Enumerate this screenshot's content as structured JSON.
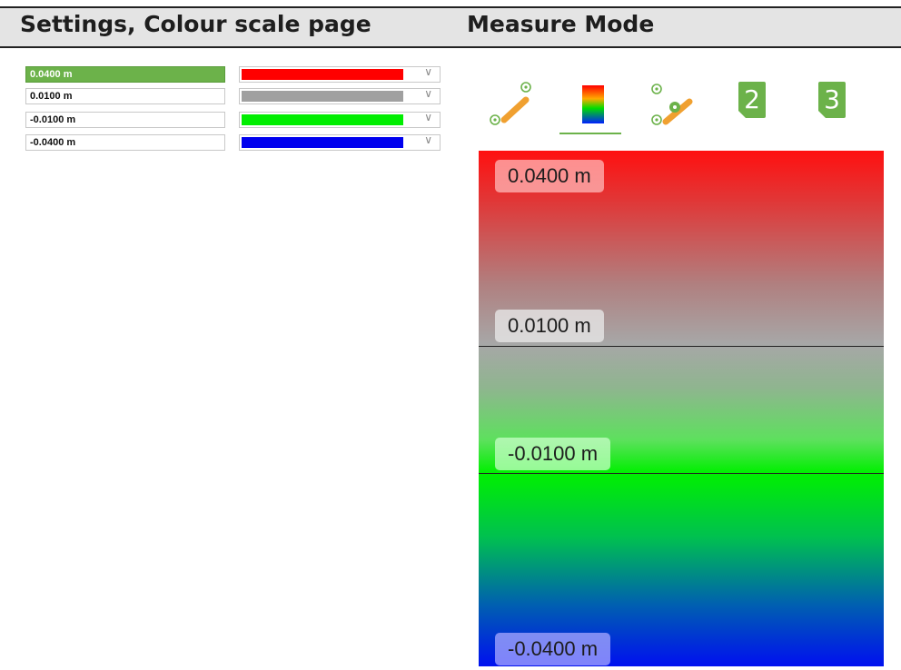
{
  "header": {
    "left_title": "Settings, Colour scale page",
    "right_title": "Measure Mode"
  },
  "colour_scale": {
    "rows": [
      {
        "value": "0.0400 m",
        "color": "#ff0000",
        "selected": true
      },
      {
        "value": "0.0100 m",
        "color": "#a0a0a0",
        "selected": false
      },
      {
        "value": "-0.0100 m",
        "color": "#00ee00",
        "selected": false
      },
      {
        "value": "-0.0400 m",
        "color": "#0000ee",
        "selected": false
      }
    ],
    "dropdown_glyph": "∨"
  },
  "measure_mode": {
    "toolbar": [
      {
        "name": "point-to-line-icon"
      },
      {
        "name": "colour-scale-icon",
        "active": true
      },
      {
        "name": "two-point-line-icon"
      },
      {
        "name": "page-2-icon",
        "label": "2"
      },
      {
        "name": "page-3-icon",
        "label": "3"
      }
    ],
    "levels": [
      "0.0400 m",
      "0.0100 m",
      "-0.0100 m",
      "-0.0400 m"
    ],
    "colors": {
      "accent": "#6cb24a",
      "red": "#ff1010",
      "grey": "#a7a7a7",
      "green": "#00f000",
      "blue": "#0010f0"
    }
  }
}
